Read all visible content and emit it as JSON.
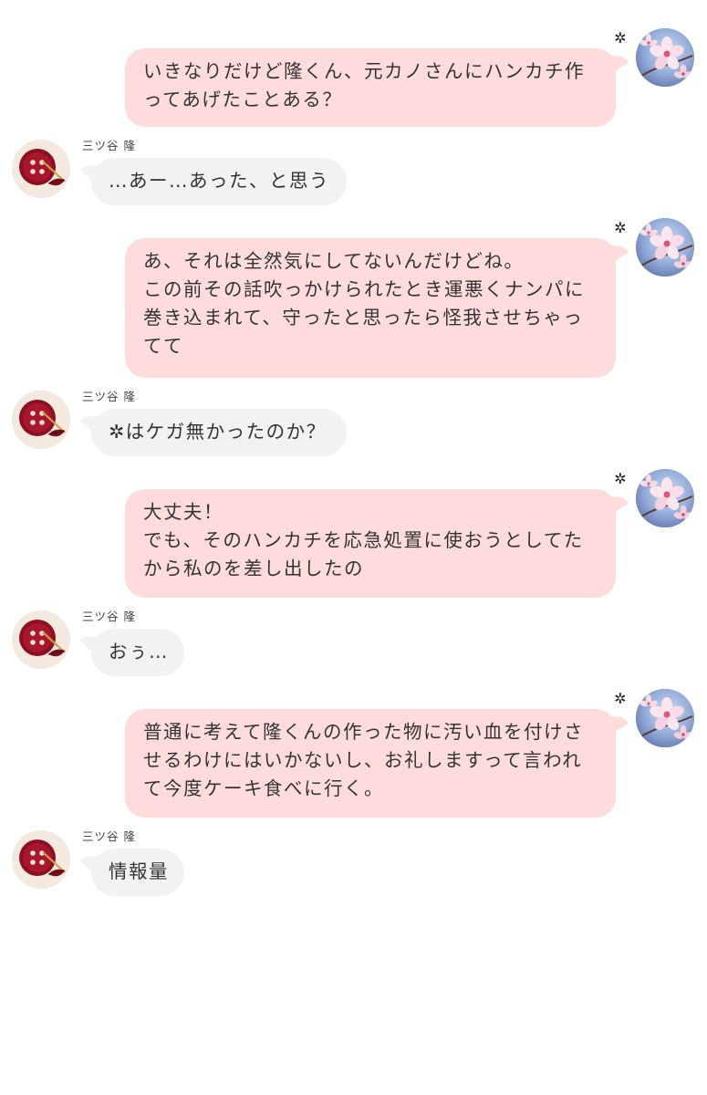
{
  "app": {
    "background": "#ffffff",
    "self_bubble_color": "#ffdcdc",
    "other_bubble_color": "#f2f2f2"
  },
  "self": {
    "name_mark": "✲",
    "avatar": "cherry-blossom-avatar"
  },
  "other": {
    "name": "三ツ谷 隆",
    "avatar": "red-button-needle-avatar"
  },
  "messages": [
    {
      "side": "right",
      "text": "いきなりだけど隆くん、元カノさんにハンカチ作ってあげたことある？"
    },
    {
      "side": "left",
      "text": "…あー…あった、と思う"
    },
    {
      "side": "right",
      "text": "あ、それは全然気にしてないんだけどね。\nこの前その話吹っかけられたとき運悪くナンパに巻き込まれて、守ったと思ったら怪我させちゃってて"
    },
    {
      "side": "left",
      "text": "✲はケガ無かったのか？"
    },
    {
      "side": "right",
      "text": "大丈夫！\nでも、そのハンカチを応急処置に使おうとしてたから私のを差し出したの"
    },
    {
      "side": "left",
      "text": "おぅ…"
    },
    {
      "side": "right",
      "text": "普通に考えて隆くんの作った物に汚い血を付けさせるわけにはいかないし、お礼しますって言われて今度ケーキ食べに行く。"
    },
    {
      "side": "left",
      "text": "情報量"
    }
  ]
}
